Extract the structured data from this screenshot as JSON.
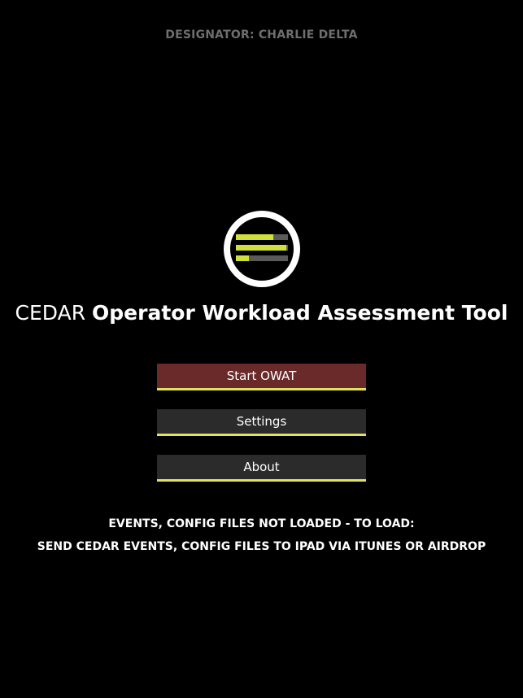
{
  "designator": "DESIGNATOR: CHARLIE DELTA",
  "title": {
    "prefix": "CEDAR",
    "main": "Operator Workload Assessment Tool"
  },
  "logo": {
    "icon": "workload-bars-icon",
    "bar_fill_fractions": [
      0.72,
      0.97,
      0.25
    ],
    "fill_color": "#cfe03a",
    "empty_color": "#5a5a5a"
  },
  "buttons": {
    "start_label": "Start OWAT",
    "settings_label": "Settings",
    "about_label": "About"
  },
  "status": {
    "line1": "EVENTS, CONFIG FILES NOT LOADED - TO LOAD:",
    "line2": "SEND CEDAR EVENTS, CONFIG FILES TO IPAD VIA ITUNES OR AIRDROP"
  },
  "colors": {
    "background": "#000000",
    "start_button": "#6a2a2a",
    "secondary_button": "#2b2b2b",
    "button_underline": "#e2e15a",
    "designator_text": "#6e6e6e"
  }
}
